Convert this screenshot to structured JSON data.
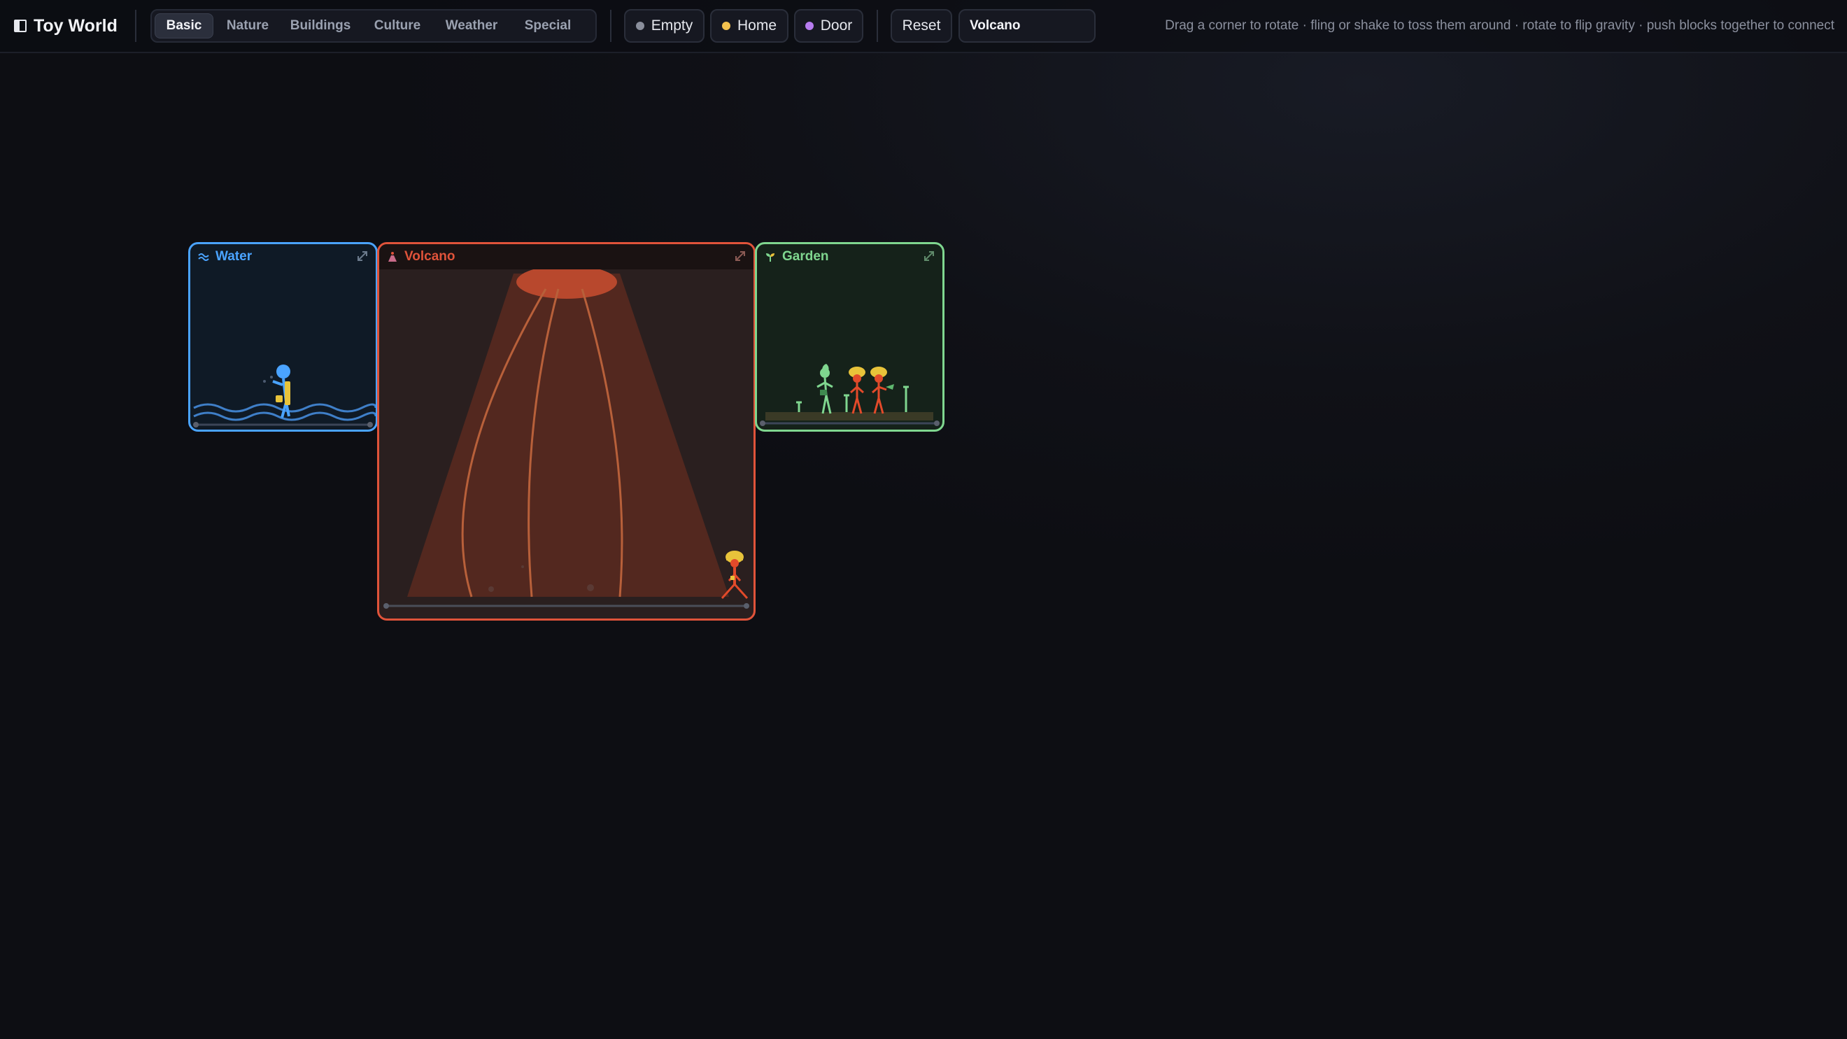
{
  "app": {
    "title": "Toy World"
  },
  "tabs": [
    {
      "label": "Basic",
      "active": true
    },
    {
      "label": "Nature",
      "active": false
    },
    {
      "label": "Buildings",
      "active": false
    },
    {
      "label": "Culture",
      "active": false
    },
    {
      "label": "Weather",
      "active": false
    },
    {
      "label": "Special",
      "active": false
    }
  ],
  "presets": [
    {
      "label": "Empty",
      "color": "#8a8f9c"
    },
    {
      "label": "Home",
      "color": "#f2c14e"
    },
    {
      "label": "Door",
      "color": "#b77cf0"
    }
  ],
  "reset_label": "Reset",
  "search": {
    "value": "Volcano"
  },
  "hint": "Drag a corner to rotate · fling or shake to toss them around · rotate to flip gravity · push blocks together to connect",
  "blocks": {
    "water": {
      "label": "Water",
      "icon": "wave-icon",
      "accent": "#4aa3ff",
      "bg": "#0f1a26"
    },
    "volcano": {
      "label": "Volcano",
      "icon": "volcano-icon",
      "accent": "#e0533a",
      "bg": "#2a1f1f"
    },
    "garden": {
      "label": "Garden",
      "icon": "sprout-icon",
      "accent": "#7fd68f",
      "bg": "#15221a"
    }
  }
}
